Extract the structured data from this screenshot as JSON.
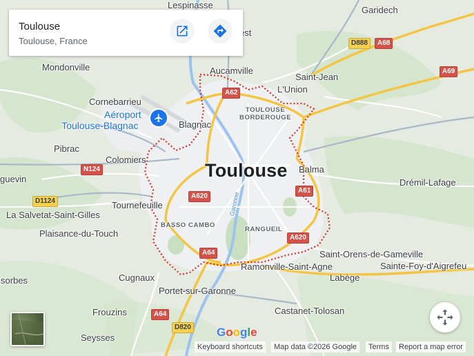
{
  "place_card": {
    "title": "Toulouse",
    "subtitle": "Toulouse, France",
    "open_icon": "open-in-new-icon",
    "directions_icon": "directions-icon"
  },
  "map": {
    "center_label": "Toulouse",
    "airport_label_line1": "Aéroport",
    "airport_label_line2": "Toulouse-Blagnac",
    "river": "Garonne",
    "places": {
      "lespinasse": "Lespinasse",
      "garidech": "Garidech",
      "mondonville": "Mondonville",
      "aucamville": "Aucamville",
      "saint_jean": "Saint-Jean",
      "lunion": "L'Union",
      "cornebarrieu": "Cornebarrieu",
      "blagnac": "Blagnac",
      "pibrac": "Pibrac",
      "colomiers": "Colomiers",
      "balma": "Balma",
      "dremil": "Drémil-Lafage",
      "leguevin": "guevin",
      "tournefeuille": "Tournefeuille",
      "salvetat": "La Salvetat-Saint-Gilles",
      "plaisance": "Plaisance-du-Touch",
      "saint_orens": "Saint-Orens-de-Gameville",
      "sainte_foy": "Sainte-Foy-d'Aigrefeu",
      "cugnaux": "Cugnaux",
      "ramonville": "Ramonville-Saint-Agne",
      "labege": "Labège",
      "sorbes": "sorbes",
      "portet": "Portet-sur-Garonne",
      "castanet": "Castanet-Tolosan",
      "frouzins": "Frouzins",
      "seysses": "Seysses",
      "fest": "est"
    },
    "districts": {
      "borderouge_1": "TOULOUSE",
      "borderouge_2": "BORDEROUGE",
      "basso_cambo": "BASSO CAMBO",
      "rangueil": "RANGUEIL"
    },
    "roads": {
      "a62": "A62",
      "a68": "A68",
      "a69": "A69",
      "d888": "D888",
      "n124": "N124",
      "d1124": "D1124",
      "a620_west": "A620",
      "a620_south": "A620",
      "a61": "A61",
      "a64_center": "A64",
      "a64_south": "A64",
      "d820": "D820"
    },
    "watermark": "Google",
    "faint_data": "Map data ©2026 Google"
  },
  "controls": {
    "compass_icon": "pan-arrows-icon",
    "layer_icon": "satellite-layer-thumbnail"
  },
  "footer": {
    "keyboard": "Keyboard shortcuts",
    "map_data": "Map data ©2026 Google",
    "terms": "Terms",
    "report": "Report a map error"
  },
  "colors": {
    "boundary": "#d93025",
    "accent": "#1a73e8",
    "motorway": "#f6c844",
    "road": "#ffffff"
  }
}
